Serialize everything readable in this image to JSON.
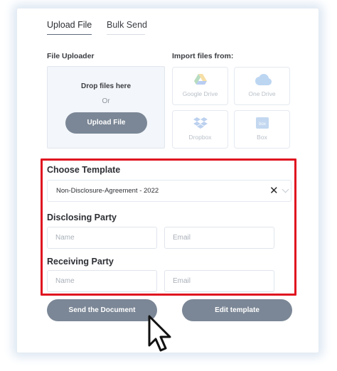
{
  "tabs": [
    {
      "label": "Upload File",
      "active": true
    },
    {
      "label": "Bulk Send",
      "active": false
    }
  ],
  "uploader": {
    "label": "File Uploader",
    "drop_text": "Drop files here",
    "or_text": "Or",
    "button_label": "Upload File"
  },
  "import": {
    "label": "Import files from:",
    "sources": [
      {
        "label": "Google Drive",
        "icon": "google-drive-icon"
      },
      {
        "label": "One Drive",
        "icon": "onedrive-cloud-icon"
      },
      {
        "label": "Dropbox",
        "icon": "dropbox-icon"
      },
      {
        "label": "Box",
        "icon": "box-icon"
      }
    ]
  },
  "template": {
    "label": "Choose Template",
    "selected": "Non-Disclosure-Agreement - 2022"
  },
  "disclosing": {
    "label": "Disclosing Party",
    "name_placeholder": "Name",
    "email_placeholder": "Email"
  },
  "receiving": {
    "label": "Receiving Party",
    "name_placeholder": "Name",
    "email_placeholder": "Email"
  },
  "actions": {
    "send_label": "Send the Document",
    "edit_label": "Edit template"
  },
  "colors": {
    "button": "#7b8796",
    "highlight": "#e01320",
    "panel_bg": "#f3f6fa"
  }
}
